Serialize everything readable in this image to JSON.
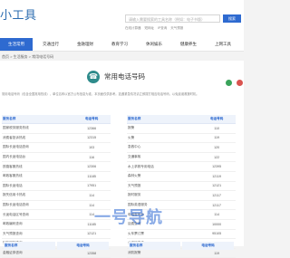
{
  "header": {
    "logo": "小工具",
    "search_placeholder": "请输入需要搜索的工具名称（例如：电子书版）",
    "search_button": "搜索",
    "hotlinks": [
      "在线计算器",
      "短网址",
      "IP查询",
      "天气预报"
    ]
  },
  "nav": {
    "items": [
      "生活常用",
      "交通出行",
      "金融理财",
      "教育学习",
      "休闲娱乐",
      "健康养生",
      "上网工具"
    ],
    "active_index": 0
  },
  "breadcrumb": "首页 > 生活服务 > 常用电话号码",
  "page": {
    "title": "常用电话号码",
    "notice": "常用电话号码（包含全国常用热线），单位名称以官方公布信息为准，本页面仅供参考。如遇紧急情况请立即拨打相应电话号码，以免延误救援时机。"
  },
  "colors": {
    "accent": "#2e6ad0",
    "icon": "#2e8b8b"
  },
  "icons": {
    "phone": "phone-icon",
    "share_wechat": "wechat-icon",
    "share_weibo": "weibo-icon"
  },
  "table_left": {
    "headers": [
      "服务名称",
      "电话号码"
    ],
    "rows": [
      [
        "国家税务服务热线",
        "12366"
      ],
      [
        "消费者投诉热线",
        "12315"
      ],
      [
        "国际长途电话查询",
        "103"
      ],
      [
        "国内长途电话台",
        "116"
      ],
      [
        "铁路客服热线",
        "12306"
      ],
      [
        "邮政客服热线",
        "11185"
      ],
      [
        "国际长途电话",
        "17951"
      ],
      [
        "报失信用卡热线",
        "114"
      ],
      [
        "国际长途电话查询",
        "114"
      ],
      [
        "长途电话区号查询",
        "114"
      ],
      [
        "邮政编码查询",
        "11185"
      ],
      [
        "天气预报查询",
        "12121"
      ],
      [
        "列车时刻查询",
        "95105"
      ],
      [
        "金融证券咨询",
        "12358"
      ]
    ],
    "second_headers": [
      "服务名称",
      "电话号码"
    ]
  },
  "table_right": {
    "headers": [
      "服务名称",
      "电话号码"
    ],
    "rows": [
      [
        "报警",
        "110"
      ],
      [
        "火警",
        "119"
      ],
      [
        "急救中心",
        "120"
      ],
      [
        "交通事故",
        "122"
      ],
      [
        "水上求救专用电话",
        "12395"
      ],
      [
        "森林火警",
        "12119"
      ],
      [
        "天气预报",
        "12121"
      ],
      [
        "报时服务",
        "12117"
      ],
      [
        "国际英语服务",
        "12117"
      ],
      [
        "电话查号台",
        "114"
      ],
      [
        "话费查询",
        "10000"
      ],
      [
        "火车票订票",
        "95105"
      ],
      [
        "公安局电话",
        "110"
      ],
      [
        "消防报警",
        "119"
      ]
    ],
    "second_headers": [
      "服务名称",
      "电话号码"
    ]
  },
  "watermark": "一号导航"
}
